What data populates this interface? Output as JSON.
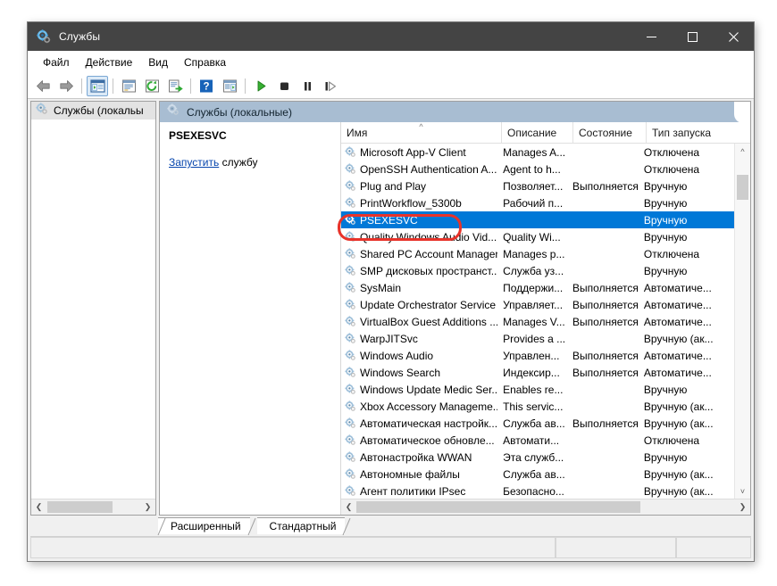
{
  "window": {
    "title": "Службы",
    "title_icon": "services-gear-icon",
    "controls": {
      "minimize": "minimize-icon",
      "maximize": "maximize-icon",
      "close": "close-icon"
    }
  },
  "menu": {
    "items": [
      {
        "label": "Файл"
      },
      {
        "label": "Действие"
      },
      {
        "label": "Вид"
      },
      {
        "label": "Справка"
      }
    ]
  },
  "toolbar": {
    "buttons": [
      {
        "name": "back-icon"
      },
      {
        "name": "forward-icon"
      },
      {
        "name": "show-hide-console-tree-icon"
      },
      {
        "name": "properties-icon"
      },
      {
        "name": "refresh-icon"
      },
      {
        "name": "export-list-icon"
      },
      {
        "name": "help-icon"
      },
      {
        "name": "show-action-pane-icon"
      },
      {
        "name": "start-service-icon"
      },
      {
        "name": "stop-service-icon"
      },
      {
        "name": "pause-service-icon"
      },
      {
        "name": "restart-service-icon"
      }
    ]
  },
  "tree": {
    "item_label": "Службы (локальы"
  },
  "right_pane": {
    "header": "Службы (локальные)",
    "detail": {
      "service_name": "PSEXESVC",
      "action_link": "Запустить",
      "action_suffix": " службу"
    }
  },
  "list": {
    "columns": [
      {
        "label": "Имя",
        "sort": "asc"
      },
      {
        "label": "Описание"
      },
      {
        "label": "Состояние"
      },
      {
        "label": "Тип запуска"
      }
    ],
    "rows": [
      {
        "name": "Microsoft App-V Client",
        "description": "Manages A...",
        "state": "",
        "startup": "Отключена",
        "selected": false
      },
      {
        "name": "OpenSSH Authentication A...",
        "description": "Agent to h...",
        "state": "",
        "startup": "Отключена",
        "selected": false
      },
      {
        "name": "Plug and Play",
        "description": "Позволяет...",
        "state": "Выполняется",
        "startup": "Вручную",
        "selected": false
      },
      {
        "name": "PrintWorkflow_5300b",
        "description": "Рабочий п...",
        "state": "",
        "startup": "Вручную",
        "selected": false
      },
      {
        "name": "PSEXESVC",
        "description": "",
        "state": "",
        "startup": "Вручную",
        "selected": true
      },
      {
        "name": "Quality Windows Audio Vid...",
        "description": "Quality Wi...",
        "state": "",
        "startup": "Вручную",
        "selected": false
      },
      {
        "name": "Shared PC Account Manager",
        "description": "Manages p...",
        "state": "",
        "startup": "Отключена",
        "selected": false
      },
      {
        "name": "SMP дисковых пространст...",
        "description": "Служба уз...",
        "state": "",
        "startup": "Вручную",
        "selected": false
      },
      {
        "name": "SysMain",
        "description": "Поддержи...",
        "state": "Выполняется",
        "startup": "Автоматиче...",
        "selected": false
      },
      {
        "name": "Update Orchestrator Service",
        "description": "Управляет...",
        "state": "Выполняется",
        "startup": "Автоматиче...",
        "selected": false
      },
      {
        "name": "VirtualBox Guest Additions ...",
        "description": "Manages V...",
        "state": "Выполняется",
        "startup": "Автоматиче...",
        "selected": false
      },
      {
        "name": "WarpJITSvc",
        "description": "Provides a ...",
        "state": "",
        "startup": "Вручную (ак...",
        "selected": false
      },
      {
        "name": "Windows Audio",
        "description": "Управлен...",
        "state": "Выполняется",
        "startup": "Автоматиче...",
        "selected": false
      },
      {
        "name": "Windows Search",
        "description": "Индексир...",
        "state": "Выполняется",
        "startup": "Автоматиче...",
        "selected": false
      },
      {
        "name": "Windows Update Medic Ser...",
        "description": "Enables re...",
        "state": "",
        "startup": "Вручную",
        "selected": false
      },
      {
        "name": "Xbox Accessory Manageme...",
        "description": "This servic...",
        "state": "",
        "startup": "Вручную (ак...",
        "selected": false
      },
      {
        "name": "Автоматическая настройк...",
        "description": "Служба ав...",
        "state": "Выполняется",
        "startup": "Вручную (ак...",
        "selected": false
      },
      {
        "name": "Автоматическое обновле...",
        "description": "Автомати...",
        "state": "",
        "startup": "Отключена",
        "selected": false
      },
      {
        "name": "Автонастройка WWAN",
        "description": "Эта служб...",
        "state": "",
        "startup": "Вручную",
        "selected": false
      },
      {
        "name": "Автономные файлы",
        "description": "Служба ав...",
        "state": "",
        "startup": "Вручную (ак...",
        "selected": false
      },
      {
        "name": "Агент политики IPsec",
        "description": "Безопасно...",
        "state": "",
        "startup": "Вручную (ак...",
        "selected": false
      }
    ]
  },
  "tabs": [
    {
      "label": "Расширенный",
      "active": true
    },
    {
      "label": "Стандартный",
      "active": false
    }
  ],
  "colors": {
    "titlebar": "#444444",
    "selection": "#0078d7",
    "pane_header": "#a8bdd2",
    "annotation": "#e8332a",
    "link": "#0645ad"
  }
}
